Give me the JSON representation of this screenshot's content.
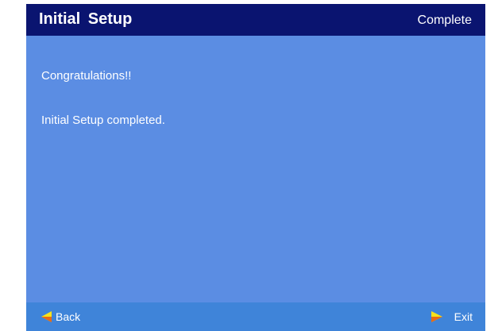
{
  "header": {
    "title": "Initial  Setup",
    "status": "Complete"
  },
  "content": {
    "message_1": "Congratulations!!",
    "message_2": "Initial Setup completed."
  },
  "footer": {
    "back_label": "Back",
    "back_icon": "arrow-left-icon",
    "exit_label": "Exit",
    "exit_icon": "arrow-right-icon"
  },
  "colors": {
    "header_bg": "#0a1470",
    "content_bg": "#5b8de3",
    "footer_bg": "#3f84d9",
    "arrow_yellow": "#f7e21b",
    "arrow_orange": "#e86a16",
    "text": "#ffffff"
  }
}
